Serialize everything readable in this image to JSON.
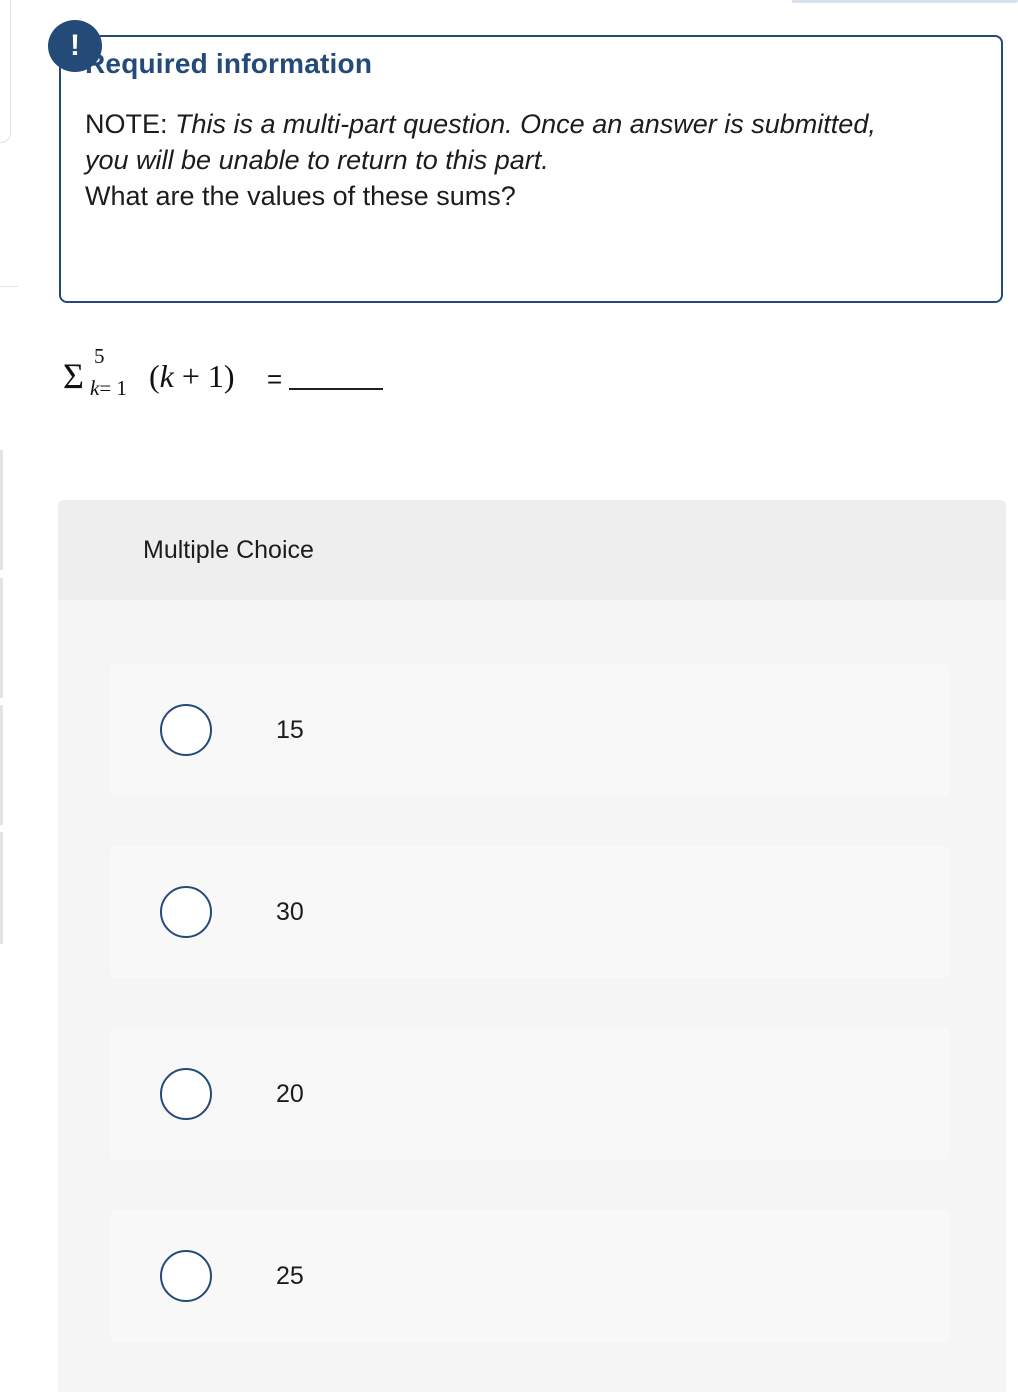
{
  "alert": {
    "badge_icon": "exclamation-icon",
    "badge_glyph": "!",
    "title": "Required information",
    "note_label": "NOTE:",
    "note_italic": "This is a multi-part question. Once an answer is submitted, you will be unable to return to this part.",
    "question": "What are the values of these sums?"
  },
  "math": {
    "sigma": "Σ",
    "upper_limit": "5",
    "lower_limit_var": "k",
    "lower_limit_rest": "= 1",
    "open_paren": "(",
    "var": "k",
    "operator": " + ",
    "constant": "1)",
    "equals": "="
  },
  "multiple_choice": {
    "title": "Multiple Choice",
    "options": [
      {
        "label": "15"
      },
      {
        "label": "30"
      },
      {
        "label": "20"
      },
      {
        "label": "25"
      }
    ]
  },
  "colors": {
    "accent": "#234a79",
    "panel_bg": "#f5f5f5",
    "header_bg": "#eeeeee"
  }
}
